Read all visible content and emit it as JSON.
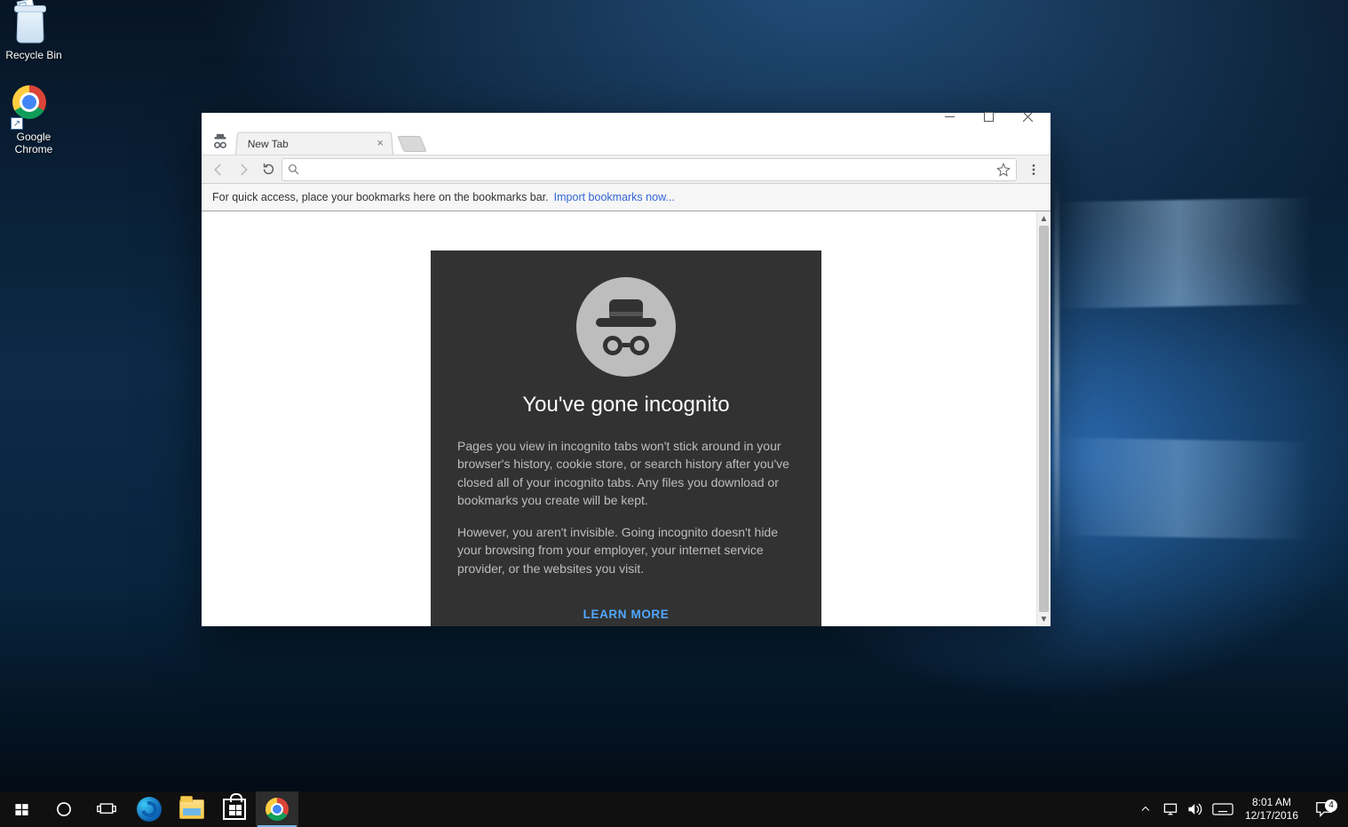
{
  "desktop": {
    "icons": [
      {
        "name": "recycle-bin",
        "label": "Recycle Bin"
      },
      {
        "name": "google-chrome",
        "label": "Google\nChrome"
      }
    ]
  },
  "chrome": {
    "tab_title": "New Tab",
    "omnibox_value": "",
    "bookmarks_hint": "For quick access, place your bookmarks here on the bookmarks bar.",
    "bookmarks_link": "Import bookmarks now...",
    "incognito": {
      "heading": "You've gone incognito",
      "p1": "Pages you view in incognito tabs won't stick around in your browser's history, cookie store, or search history after you've closed all of your incognito tabs. Any files you download or bookmarks you create will be kept.",
      "p2": "However, you aren't invisible. Going incognito doesn't hide your browsing from your employer, your internet service provider, or the websites you visit.",
      "learn_more": "LEARN MORE"
    }
  },
  "taskbar": {
    "time": "8:01 AM",
    "date": "12/17/2016",
    "notification_count": "4"
  }
}
